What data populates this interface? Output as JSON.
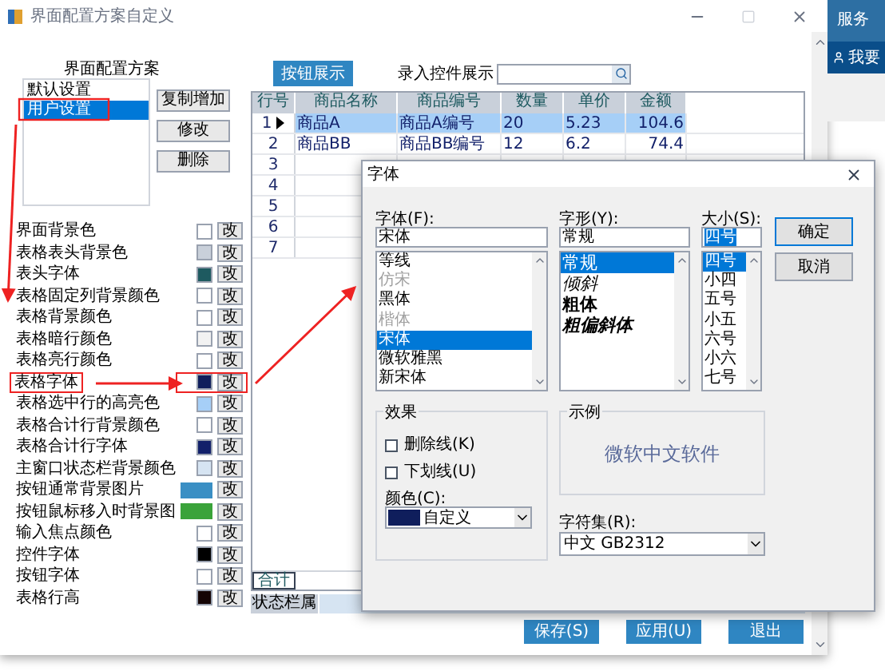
{
  "window": {
    "title": "界面配置方案自定义"
  },
  "schemes": {
    "label": "界面配置方案",
    "items": [
      {
        "label": "默认设置",
        "selected": false
      },
      {
        "label": "用户设置",
        "selected": true
      }
    ],
    "buttons": [
      "复制增加",
      "修改",
      "删除"
    ]
  },
  "properties": [
    {
      "label": "界面背景色",
      "kind": "color",
      "color": "#ffffff",
      "button": "改"
    },
    {
      "label": "表格表头背景色",
      "kind": "color",
      "color": "#c9d0da",
      "button": "改"
    },
    {
      "label": "表头字体",
      "kind": "color",
      "color": "#1e5a60",
      "button": "改"
    },
    {
      "label": "表格固定列背景颜色",
      "kind": "color",
      "color": "#ffffff",
      "button": "改"
    },
    {
      "label": "表格背景颜色",
      "kind": "color",
      "color": "#ffffff",
      "button": "改"
    },
    {
      "label": "表格暗行颜色",
      "kind": "color",
      "color": "#f2f2f2",
      "button": "改"
    },
    {
      "label": "表格亮行颜色",
      "kind": "color",
      "color": "#ffffff",
      "button": "改"
    },
    {
      "label": "表格字体",
      "kind": "color",
      "color": "#0f1e5c",
      "button": "改",
      "highlighted": true
    },
    {
      "label": "表格选中行的高亮色",
      "kind": "color",
      "color": "#a6cff7",
      "button": "改"
    },
    {
      "label": "表格合计行背景颜色",
      "kind": "color",
      "color": "#ffffff",
      "button": "改"
    },
    {
      "label": "表格合计行字体",
      "kind": "color",
      "color": "#12206a",
      "button": "改"
    },
    {
      "label": "主窗口状态栏背景颜色",
      "kind": "color",
      "color": "#d6e4f2",
      "button": "改"
    },
    {
      "label": "按钮通常背景图片",
      "kind": "image",
      "color": "#3a8fc4",
      "button": "改"
    },
    {
      "label": "按钮鼠标移入时背景图",
      "kind": "image",
      "color": "#3aa33a",
      "button": "改"
    },
    {
      "label": "输入焦点颜色",
      "kind": "color",
      "color": "#ffffff",
      "button": "改"
    },
    {
      "label": "控件字体",
      "kind": "color",
      "color": "#000000",
      "button": "改"
    },
    {
      "label": "按钮字体",
      "kind": "color",
      "color": "#ffffff",
      "button": "改"
    },
    {
      "label": "表格行高",
      "kind": "color",
      "color": "#140404",
      "button": "改"
    }
  ],
  "preview": {
    "button": "按钮展示",
    "input_label": "录入控件展示",
    "grid": {
      "columns": [
        "行号",
        "商品名称",
        "商品编号",
        "数量",
        "单价",
        "金额"
      ],
      "rows": [
        {
          "cells": [
            "1",
            "商品A",
            "商品A编号",
            "20",
            "5.23",
            "104.6"
          ],
          "selected": true
        },
        {
          "cells": [
            "2",
            "商品BB",
            "商品BB编号",
            "12",
            "6.2",
            "74.4"
          ],
          "selected": false
        },
        {
          "cells": [
            "3"
          ],
          "selected": false
        },
        {
          "cells": [
            "4"
          ],
          "selected": false
        },
        {
          "cells": [
            "5"
          ],
          "selected": false
        },
        {
          "cells": [
            "6"
          ],
          "selected": false
        },
        {
          "cells": [
            "7"
          ],
          "selected": false
        }
      ],
      "total_label": "合计"
    },
    "status_bar": "状态栏属"
  },
  "footer_buttons": [
    "保存(S)",
    "应用(U)",
    "退出"
  ],
  "side_panel": {
    "title": "服务",
    "link": "我要"
  },
  "font_dialog": {
    "title": "字体",
    "font": {
      "label": "字体(F):",
      "value": "宋体",
      "items": [
        {
          "label": "等线",
          "selected": false,
          "disabled": false
        },
        {
          "label": "仿宋",
          "selected": false,
          "disabled": true
        },
        {
          "label": "黑体",
          "selected": false,
          "disabled": false
        },
        {
          "label": "楷体",
          "selected": false,
          "disabled": true
        },
        {
          "label": "宋体",
          "selected": true,
          "disabled": false
        },
        {
          "label": "微软雅黑",
          "selected": false,
          "disabled": false
        },
        {
          "label": "新宋体",
          "selected": false,
          "disabled": false
        }
      ]
    },
    "style": {
      "label": "字形(Y):",
      "value": "常规",
      "items": [
        {
          "label": "常规",
          "kind": "regular",
          "selected": true
        },
        {
          "label": "倾斜",
          "kind": "italic",
          "selected": false
        },
        {
          "label": "粗体",
          "kind": "bold",
          "selected": false
        },
        {
          "label": "粗偏斜体",
          "kind": "bold_italic",
          "selected": false
        }
      ]
    },
    "size": {
      "label": "大小(S):",
      "value": "四号",
      "items": [
        {
          "label": "四号",
          "selected": true
        },
        {
          "label": "小四",
          "selected": false
        },
        {
          "label": "五号",
          "selected": false
        },
        {
          "label": "小五",
          "selected": false
        },
        {
          "label": "六号",
          "selected": false
        },
        {
          "label": "小六",
          "selected": false
        },
        {
          "label": "七号",
          "selected": false
        }
      ]
    },
    "buttons": [
      "确定",
      "取消"
    ],
    "effects": {
      "title": "效果",
      "options": [
        {
          "label": "删除线(K)",
          "checked": false
        },
        {
          "label": "下划线(U)",
          "checked": false
        }
      ],
      "color_label": "颜色(C):",
      "color": {
        "color": "#0f1e5c",
        "label": "自定义"
      }
    },
    "sample": {
      "title": "示例",
      "text": "微软中文软件"
    },
    "charset": {
      "label": "字符集(R):",
      "value": "中文 GB2312"
    }
  }
}
